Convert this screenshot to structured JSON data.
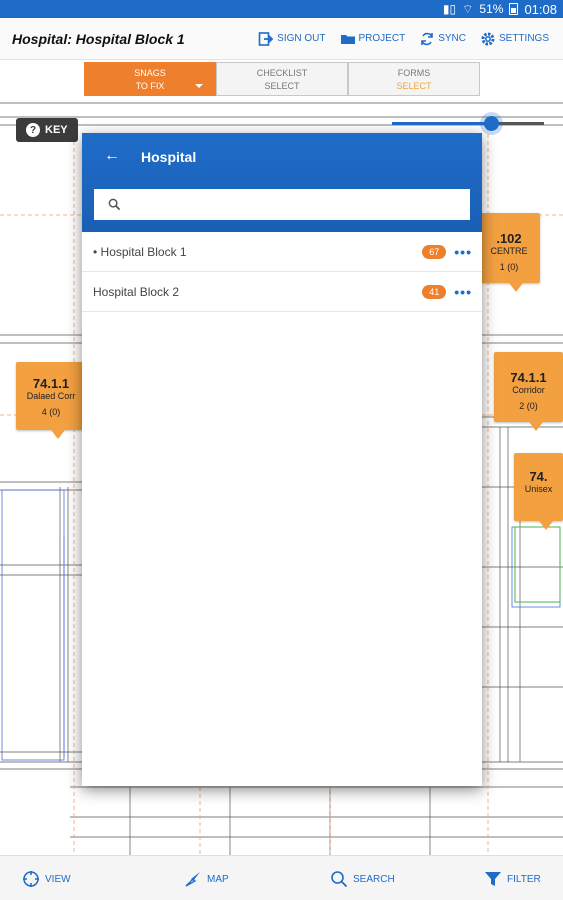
{
  "status_bar": {
    "battery": "51%",
    "time": "01:08"
  },
  "app_bar": {
    "title": "Hospital: Hospital Block 1",
    "actions": [
      {
        "label": "SIGN OUT",
        "icon": "sign-out-icon"
      },
      {
        "label": "PROJECT",
        "icon": "folder-icon"
      },
      {
        "label": "SYNC",
        "icon": "sync-icon"
      },
      {
        "label": "SETTINGS",
        "icon": "gear-icon"
      }
    ]
  },
  "tabs": [
    {
      "line1": "SNAGS",
      "line2": "TO FIX"
    },
    {
      "line1": "CHECKLIST",
      "line2": "SELECT"
    },
    {
      "line1": "FORMS",
      "line2": "SELECT"
    }
  ],
  "key_button": {
    "label": "KEY"
  },
  "zoom_level": 0.66,
  "pins": [
    {
      "num": "74.1.1",
      "sub1": "Dalaed Corr",
      "sub2": "4 (0)"
    },
    {
      "num": ".102",
      "sub1": "CENTRE",
      "sub2": "1 (0)"
    },
    {
      "num": "74.1.1",
      "sub1": "Corridor",
      "sub2": "2 (0)"
    },
    {
      "num": "74.",
      "sub1": "Unisex",
      "sub2": ""
    }
  ],
  "panel": {
    "title": "Hospital",
    "search_placeholder": "",
    "items": [
      {
        "label": "• Hospital Block 1",
        "count": "67"
      },
      {
        "label": "Hospital Block 2",
        "count": "41"
      }
    ]
  },
  "bottom_nav": [
    {
      "label": "VIEW",
      "icon": "crosshair-icon"
    },
    {
      "label": "MAP",
      "icon": "compass-icon"
    },
    {
      "label": "SEARCH",
      "icon": "search-icon"
    },
    {
      "label": "FILTER",
      "icon": "filter-icon"
    }
  ],
  "colors": {
    "primary": "#1e6bc8",
    "accent": "#ee7f2d",
    "pin": "#f3a041"
  }
}
